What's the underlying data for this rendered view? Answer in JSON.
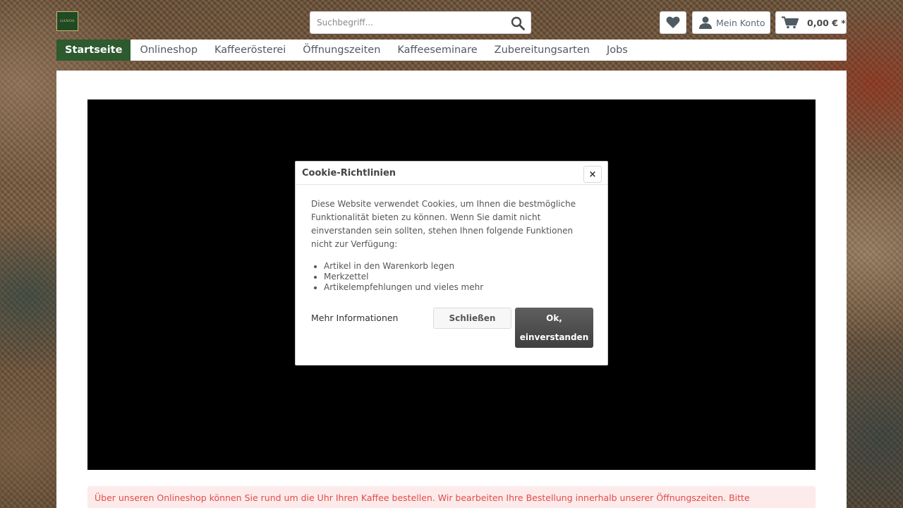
{
  "header": {
    "logo_text": "GANOS",
    "search_placeholder": "Suchbegriff...",
    "account_label": "Mein Konto",
    "cart_total": "0,00 € *"
  },
  "nav": {
    "items": [
      {
        "label": "Startseite",
        "active": true
      },
      {
        "label": "Onlineshop"
      },
      {
        "label": "Kaffeerösterei"
      },
      {
        "label": "Öffnungszeiten"
      },
      {
        "label": "Kaffeeseminare"
      },
      {
        "label": "Zubereitungsarten"
      },
      {
        "label": "Jobs"
      }
    ]
  },
  "cookie_modal": {
    "title": "Cookie-Richtlinien",
    "close_symbol": "×",
    "text": "Diese Website verwendet Cookies, um Ihnen die bestmögliche Funktionalität bieten zu können. Wenn Sie damit nicht einverstanden sein sollten, stehen Ihnen folgende Funktionen nicht zur Verfügung:",
    "features": [
      "Artikel in den Warenkorb legen",
      "Merkzettel",
      "Artikelempfehlungen und vieles mehr"
    ],
    "more_info_label": "Mehr Informationen",
    "close_button_label": "Schließen",
    "accept_button_label": "Ok, einverstanden"
  },
  "notice": {
    "text": "Über unseren Onlineshop können Sie rund um die Uhr Ihren Kaffee bestellen. Wir bearbeiten Ihre Bestellung innerhalb unserer Öffnungszeiten. Bitte"
  },
  "colors": {
    "nav_active": "#2d5a2f",
    "notice_text": "#e34b4b",
    "notice_bg": "#fcebea",
    "accept_button": "#4a4a4a"
  }
}
